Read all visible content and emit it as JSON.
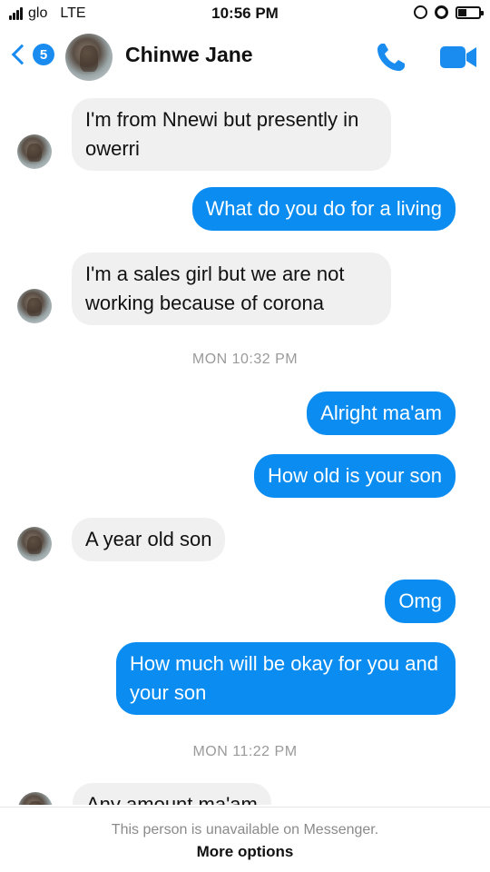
{
  "status_bar": {
    "carrier": "glo",
    "network": "LTE",
    "time": "10:56 PM"
  },
  "header": {
    "back_badge_count": "5",
    "contact_name": "Chinwe Jane",
    "icons": {
      "back": "chevron-left-icon",
      "call": "phone-icon",
      "video": "video-camera-icon"
    }
  },
  "colors": {
    "accent": "#0a8cf0",
    "incoming_bubble": "#f1f0f0",
    "timestamp_text": "#9a9a9a"
  },
  "messages": [
    {
      "direction": "incoming",
      "text": "I'm from Nnewi but presently in owerri"
    },
    {
      "direction": "outgoing",
      "text": "What do you do for a living"
    },
    {
      "direction": "incoming",
      "text": "I'm a sales girl but we are not working because of corona"
    },
    {
      "direction": "outgoing",
      "text": "Alright ma'am"
    },
    {
      "direction": "outgoing",
      "text": "How old is your son"
    },
    {
      "direction": "incoming",
      "text": "A year old son"
    },
    {
      "direction": "outgoing",
      "text": "Omg"
    },
    {
      "direction": "outgoing",
      "text": "How much will be okay for you and your son"
    },
    {
      "direction": "incoming",
      "text": "Any amount ma'am"
    }
  ],
  "timestamps": [
    "MON 10:32 PM",
    "MON 11:22 PM"
  ],
  "footer": {
    "note": "This person is unavailable on Messenger.",
    "link": "More options"
  }
}
